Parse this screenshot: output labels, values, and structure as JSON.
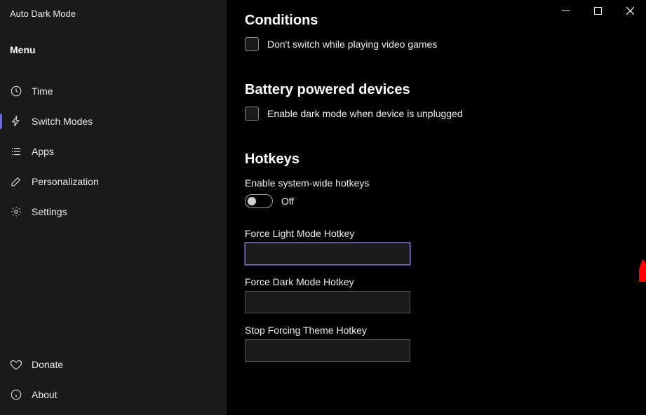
{
  "app": {
    "title": "Auto Dark Mode"
  },
  "sidebar": {
    "menu_label": "Menu",
    "items": [
      {
        "label": "Time"
      },
      {
        "label": "Switch Modes"
      },
      {
        "label": "Apps"
      },
      {
        "label": "Personalization"
      },
      {
        "label": "Settings"
      }
    ],
    "bottom": [
      {
        "label": "Donate"
      },
      {
        "label": "About"
      }
    ]
  },
  "main": {
    "conditions": {
      "heading": "Conditions",
      "games_checkbox": "Don't switch while playing video games"
    },
    "battery": {
      "heading": "Battery powered devices",
      "unplugged_checkbox": "Enable dark mode when device is unplugged"
    },
    "hotkeys": {
      "heading": "Hotkeys",
      "enable_label": "Enable system-wide hotkeys",
      "toggle_state": "Off",
      "force_light_label": "Force Light Mode Hotkey",
      "force_light_value": "",
      "force_dark_label": "Force Dark Mode Hotkey",
      "force_dark_value": "",
      "stop_force_label": "Stop Forcing Theme Hotkey",
      "stop_force_value": ""
    }
  }
}
